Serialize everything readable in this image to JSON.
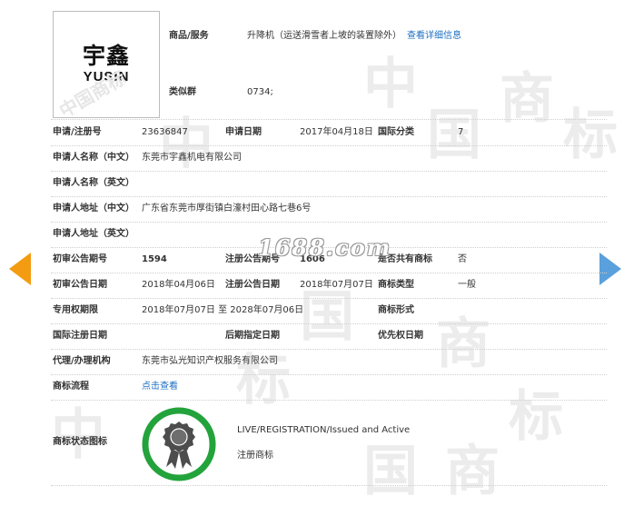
{
  "logo": {
    "cn": "宇鑫",
    "en": "YUSIN"
  },
  "goods": {
    "label": "商品/服务",
    "value": "升降机（运送滑雪者上坡的装置除外）",
    "detail_link": "查看详细信息"
  },
  "class_group": {
    "label": "类似群",
    "value": "0734;"
  },
  "reg_no": {
    "label": "申请/注册号",
    "value": "23636847"
  },
  "apply_date": {
    "label": "申请日期",
    "value": "2017年04月18日"
  },
  "intl_class": {
    "label": "国际分类",
    "value": "7"
  },
  "applicant_cn": {
    "label": "申请人名称（中文）",
    "value": "东莞市宇鑫机电有限公司"
  },
  "applicant_en": {
    "label": "申请人名称（英文）",
    "value": ""
  },
  "address_cn": {
    "label": "申请人地址（中文）",
    "value": "广东省东莞市厚街镇白濠村田心路七巷6号"
  },
  "address_en": {
    "label": "申请人地址（英文）",
    "value": ""
  },
  "prelim_no": {
    "label": "初审公告期号",
    "value": "1594"
  },
  "reg_pub_no": {
    "label": "注册公告期号",
    "value": "1606"
  },
  "shared": {
    "label": "是否共有商标",
    "value": "否"
  },
  "prelim_date": {
    "label": "初审公告日期",
    "value": "2018年04月06日"
  },
  "reg_pub_date": {
    "label": "注册公告日期",
    "value": "2018年07月07日"
  },
  "mark_type": {
    "label": "商标类型",
    "value": "一般"
  },
  "exclusive": {
    "label": "专用权期限",
    "value": "2018年07月07日 至 2028年07月06日"
  },
  "mark_form": {
    "label": "商标形式",
    "value": ""
  },
  "intl_reg_date": {
    "label": "国际注册日期",
    "value": ""
  },
  "later_date": {
    "label": "后期指定日期",
    "value": ""
  },
  "priority_date": {
    "label": "优先权日期",
    "value": ""
  },
  "agent": {
    "label": "代理/办理机构",
    "value": "东莞市弘光知识产权服务有限公司"
  },
  "process": {
    "label": "商标流程",
    "link": "点击查看"
  },
  "status": {
    "label": "商标状态图标",
    "en": "LIVE/REGISTRATION/Issued and Active",
    "cn": "注册商标",
    "seal_color": "#23a33b"
  },
  "watermarks": {
    "site": "1688.com",
    "tm": "中国商标",
    "tm_char1": "中",
    "tm_char2": "国",
    "tm_char3": "商",
    "tm_char4": "标"
  },
  "colors": {
    "link": "#1e6fc2",
    "arrow_left": "#f39c12",
    "arrow_right": "#5aa0dc"
  }
}
